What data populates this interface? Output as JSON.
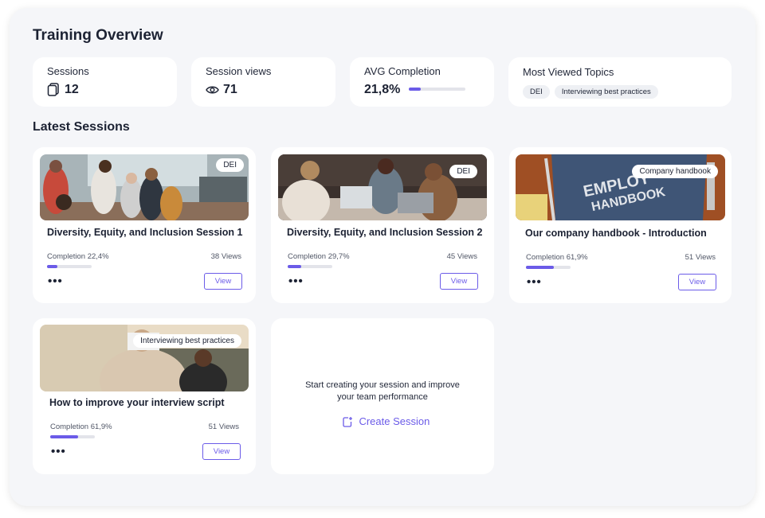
{
  "page": {
    "title": "Training Overview",
    "section_title": "Latest Sessions"
  },
  "stats": {
    "sessions": {
      "label": "Sessions",
      "value": "12",
      "icon": "copy-icon"
    },
    "views": {
      "label": "Session views",
      "value": "71",
      "icon": "eye-icon"
    },
    "completion": {
      "label": "AVG Completion",
      "value": "21,8%",
      "progress": 0.218
    },
    "topics": {
      "label": "Most Viewed Topics",
      "chips": [
        "DEI",
        "Interviewing best practices"
      ]
    }
  },
  "colors": {
    "accent": "#6b5be8",
    "panel": "#f5f6f9",
    "card": "#ffffff"
  },
  "sessions": [
    {
      "tag": "DEI",
      "title": "Diversity, Equity, and Inclusion Session 1",
      "completion_label": "Completion 22,4%",
      "progress": 0.224,
      "views": "38 Views",
      "more": "•••",
      "button": "View"
    },
    {
      "tag": "DEI",
      "title": "Diversity, Equity, and Inclusion Session 2",
      "completion_label": "Completion 29,7%",
      "progress": 0.297,
      "views": "45 Views",
      "more": "•••",
      "button": "View"
    },
    {
      "tag": "Company handbook",
      "title": "Our company handbook - Introduction",
      "completion_label": "Completion 61,9%",
      "progress": 0.619,
      "views": "51 Views",
      "more": "•••",
      "button": "View",
      "book_text_1": "EMPLOY",
      "book_text_2": "HANDBOOK"
    },
    {
      "tag": "Interviewing best practices",
      "title": "How to improve your interview script",
      "completion_label": "Completion 61,9%",
      "progress": 0.619,
      "views": "51 Views",
      "more": "•••",
      "button": "View"
    }
  ],
  "create": {
    "line1": "Start creating your session and improve",
    "line2": "your team performance",
    "button": "Create Session",
    "icon": "new-session-icon"
  }
}
